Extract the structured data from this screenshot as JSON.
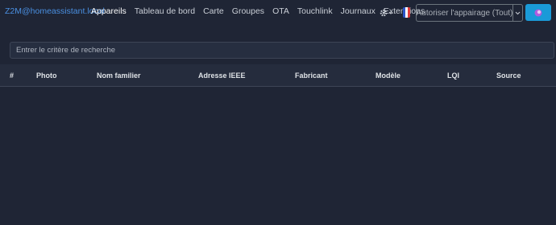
{
  "navbar": {
    "brand": "Z2M@homeassistant.local",
    "links": [
      {
        "label": "Appareils",
        "active": true
      },
      {
        "label": "Tableau de bord"
      },
      {
        "label": "Carte"
      },
      {
        "label": "Groupes"
      },
      {
        "label": "OTA"
      },
      {
        "label": "Touchlink"
      },
      {
        "label": "Journaux"
      },
      {
        "label": "Extensions"
      }
    ],
    "settings_icon": "gear-icon",
    "language_icon": "french-flag-icon",
    "pair_button_label": "Autoriser l'appairage (Tout)",
    "dropdown_icon": "chevron-down-icon",
    "permit_icon": "magic-wand-icon"
  },
  "search": {
    "placeholder": "Entrer le critère de recherche"
  },
  "table": {
    "columns": [
      "#",
      "Photo",
      "Nom familier",
      "Adresse IEEE",
      "Fabricant",
      "Modèle",
      "LQI",
      "Source"
    ]
  },
  "colors": {
    "background": "#1f2535",
    "brand": "#4a90e2",
    "primary_button": "#1a9ad8",
    "table_header": "#252c3d"
  }
}
